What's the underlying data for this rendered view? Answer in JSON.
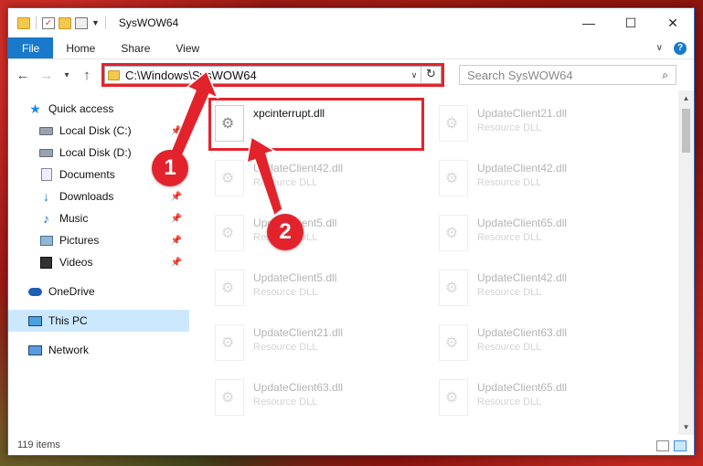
{
  "window": {
    "title": "SysWOW64",
    "minimize": "—",
    "maximize": "☐",
    "close": "✕"
  },
  "ribbon": {
    "tabs": [
      "File",
      "Home",
      "Share",
      "View"
    ],
    "expand_icon": "chevron-down-icon",
    "help_label": "?"
  },
  "nav": {
    "address": "C:\\Windows\\SysWOW64",
    "search_placeholder": "Search SysWOW64"
  },
  "sidebar": {
    "items": [
      {
        "label": "Quick access",
        "icon": "star-icon"
      },
      {
        "label": "Local Disk (C:)",
        "icon": "drive-icon",
        "pinned": true
      },
      {
        "label": "Local Disk (D:)",
        "icon": "drive-icon"
      },
      {
        "label": "Documents",
        "icon": "documents-icon",
        "pinned": true
      },
      {
        "label": "Downloads",
        "icon": "downloads-icon",
        "pinned": true
      },
      {
        "label": "Music",
        "icon": "music-icon",
        "pinned": true
      },
      {
        "label": "Pictures",
        "icon": "pictures-icon",
        "pinned": true
      },
      {
        "label": "Videos",
        "icon": "videos-icon",
        "pinned": true
      },
      {
        "label": "OneDrive",
        "icon": "onedrive-icon"
      },
      {
        "label": "This PC",
        "icon": "this-pc-icon",
        "selected": true
      },
      {
        "label": "Network",
        "icon": "network-icon"
      }
    ]
  },
  "files": [
    {
      "name": "xpcinterrupt.dll",
      "type": ""
    },
    {
      "name": "UpdateClient21.dll",
      "type": "Resource DLL"
    },
    {
      "name": "UpdateClient42.dll",
      "type": "Resource DLL"
    },
    {
      "name": "UpdateClient42.dll",
      "type": "Resource DLL"
    },
    {
      "name": "UpdateClient5.dll",
      "type": "Resource DLL"
    },
    {
      "name": "UpdateClient65.dll",
      "type": "Resource DLL"
    },
    {
      "name": "UpdateClient5.dll",
      "type": "Resource DLL"
    },
    {
      "name": "UpdateClient42.dll",
      "type": "Resource DLL"
    },
    {
      "name": "UpdateClient21.dll",
      "type": "Resource DLL"
    },
    {
      "name": "UpdateClient63.dll",
      "type": "Resource DLL"
    },
    {
      "name": "UpdateClient63.dll",
      "type": "Resource DLL"
    },
    {
      "name": "UpdateClient65.dll",
      "type": "Resource DLL"
    }
  ],
  "status": {
    "item_count": "119 items"
  },
  "callouts": {
    "step1": "1",
    "step2": "2",
    "color": "#e3232c"
  }
}
